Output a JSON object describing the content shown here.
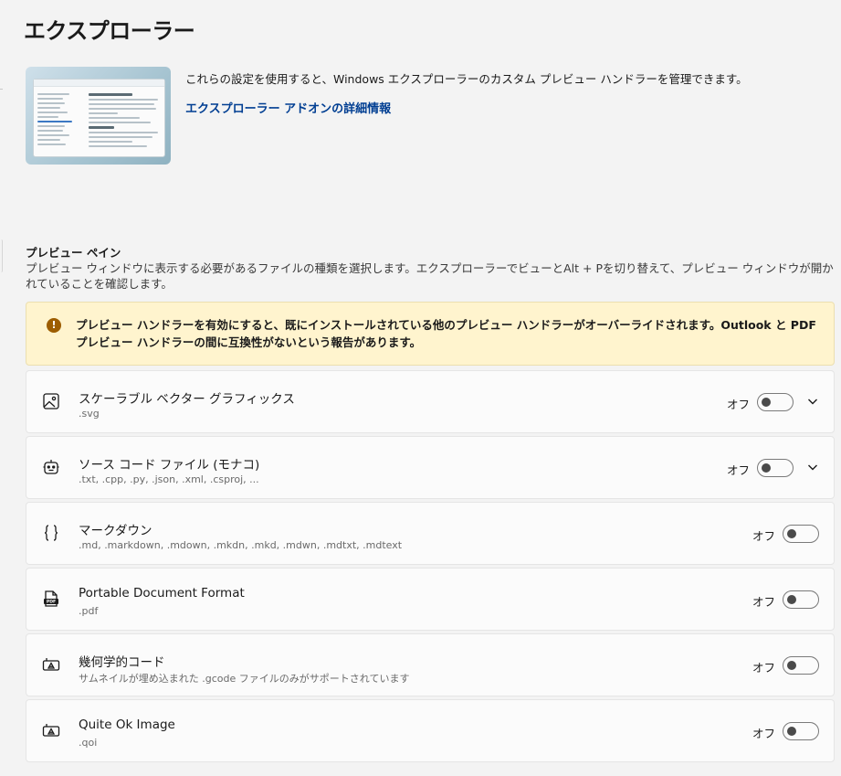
{
  "page": {
    "title": "エクスプローラー"
  },
  "hero": {
    "description": "これらの設定を使用すると、Windows エクスプローラーのカスタム プレビュー ハンドラーを管理できます。",
    "link": "エクスプローラー アドオンの詳細情報"
  },
  "section": {
    "title": "プレビュー ペイン",
    "description": "プレビュー ウィンドウに表示する必要があるファイルの種類を選択します。エクスプローラーでビューとAlt + Pを切り替えて、プレビュー ウィンドウが開かれていることを確認します。"
  },
  "warning": {
    "icon": "warning-icon",
    "text": "プレビュー ハンドラーを有効にすると、既にインストールされている他のプレビュー ハンドラーがオーバーライドされます。Outlook と PDF プレビュー ハンドラーの間に互換性がないという報告があります。"
  },
  "handlers": [
    {
      "title": "スケーラブル ベクター グラフィックス",
      "sub": ".svg",
      "state": "オフ",
      "enabled": false,
      "expandable": true,
      "icon": "image-icon"
    },
    {
      "title": "ソース コード ファイル (モナコ)",
      "sub": ".txt, .cpp, .py, .json, .xml, .csproj, ...",
      "state": "オフ",
      "enabled": false,
      "expandable": true,
      "icon": "robot-icon"
    },
    {
      "title": "マークダウン",
      "sub": ".md, .markdown, .mdown, .mkdn, .mkd, .mdwn, .mdtxt, .mdtext",
      "state": "オフ",
      "enabled": false,
      "expandable": false,
      "icon": "braces-icon"
    },
    {
      "title": "Portable Document Format",
      "sub": ".pdf",
      "state": "オフ",
      "enabled": false,
      "expandable": false,
      "icon": "pdf-icon"
    },
    {
      "title": "幾何学的コード",
      "sub": "サムネイルが埋め込まれた .gcode ファイルのみがサポートされています",
      "state": "オフ",
      "enabled": false,
      "expandable": false,
      "icon": "gcode-icon"
    },
    {
      "title": "Quite Ok Image",
      "sub": ".qoi",
      "state": "オフ",
      "enabled": false,
      "expandable": false,
      "icon": "qoi-icon"
    }
  ]
}
